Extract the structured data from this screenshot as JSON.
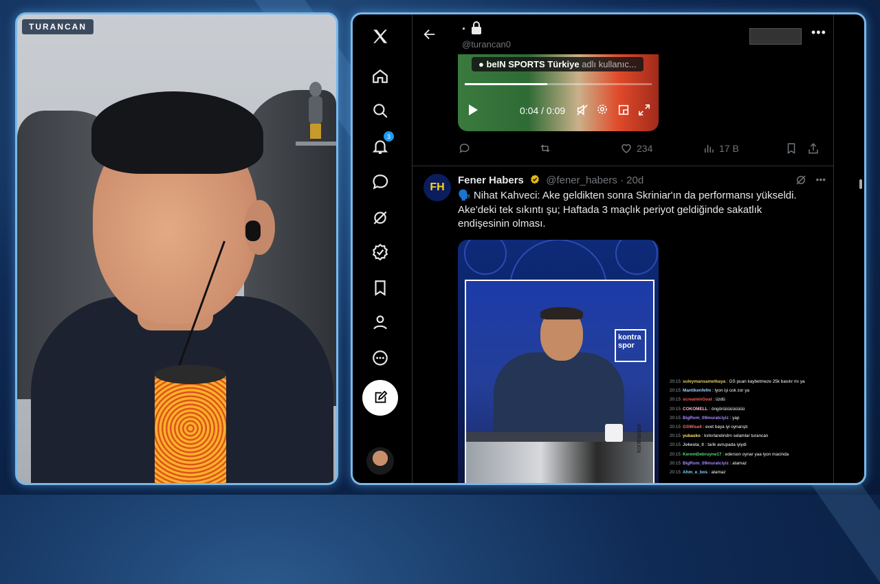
{
  "streamer": {
    "name": "TURANCAN"
  },
  "x_nav": {
    "items": [
      {
        "name": "x-logo-icon"
      },
      {
        "name": "home-icon"
      },
      {
        "name": "search-icon"
      },
      {
        "name": "notifications-icon",
        "badge": "3"
      },
      {
        "name": "messages-icon"
      },
      {
        "name": "grok-icon"
      },
      {
        "name": "verified-icon"
      },
      {
        "name": "bookmarks-icon"
      },
      {
        "name": "profile-icon"
      },
      {
        "name": "more-icon"
      }
    ]
  },
  "profile": {
    "name": ".",
    "handle": "@turancan0"
  },
  "video1": {
    "caption_bold": "beIN SPORTS Türkiye",
    "caption_dim": "adlı kullanıc...",
    "time": "0:04 / 0:09",
    "progress": 0.44
  },
  "tweet1_actions": {
    "likes": "234",
    "views": "17 B"
  },
  "tweet2": {
    "avatar_text": "FH",
    "name": "Fener Habers",
    "meta": "@fener_habers · 20d",
    "emoji": "🗣️",
    "body": "Nihat Kahveci: Ake geldikten sonra Skriniar'ın da performansı yükseldi. Ake'deki tek sıkıntı şu; Haftada 3 maçlık periyot geldiğinde sakatlık endişesinin olması.",
    "media_logo": "kontra spor",
    "media_side": "kontraspor"
  },
  "chat": [
    {
      "time": "20:15",
      "user": "suleymansametkaya",
      "color": "#e0d060",
      "msg": ": GS puan kaybetmeze 25k basılır mı ya"
    },
    {
      "time": "20:15",
      "user": "Mantikenfefm",
      "color": "#9ad0ff",
      "msg": ": lyon işi cok zor ya"
    },
    {
      "time": "20:15",
      "user": "screaminGoat",
      "color": "#ff5a5a",
      "msg": ": üzdü"
    },
    {
      "time": "20:15",
      "user": "COKOMELL",
      "color": "#ffb7d5",
      "msg": ": öngörüüüüüüüüü"
    },
    {
      "time": "20:15",
      "user": "BigRom_09muratciyiz",
      "color": "#a98bff",
      "msg": ": yap"
    },
    {
      "time": "20:15",
      "user": "GSWisa4",
      "color": "#ff6b6b",
      "msg": ": evet baya iyi oynarıştı"
    },
    {
      "time": "20:15",
      "user": "yubasko",
      "color": "#ffe26b",
      "msg": ": kırkırlarelindrn selamlar turancan"
    },
    {
      "time": "20:15",
      "user": "Jokesta_0",
      "color": "#cfcfcf",
      "msg": ": tarik avrupada iyiydi"
    },
    {
      "time": "20:15",
      "user": "KeremDebruyne17",
      "color": "#5ad67a",
      "msg": ": ederson oynar yaa lyon macinda"
    },
    {
      "time": "20:15",
      "user": "BigRom_09muratciyiz",
      "color": "#a98bff",
      "msg": ": atamaz"
    },
    {
      "time": "20:15",
      "user": "Ahm_e_bos",
      "color": "#7fd7ff",
      "msg": ": atamaz"
    }
  ]
}
